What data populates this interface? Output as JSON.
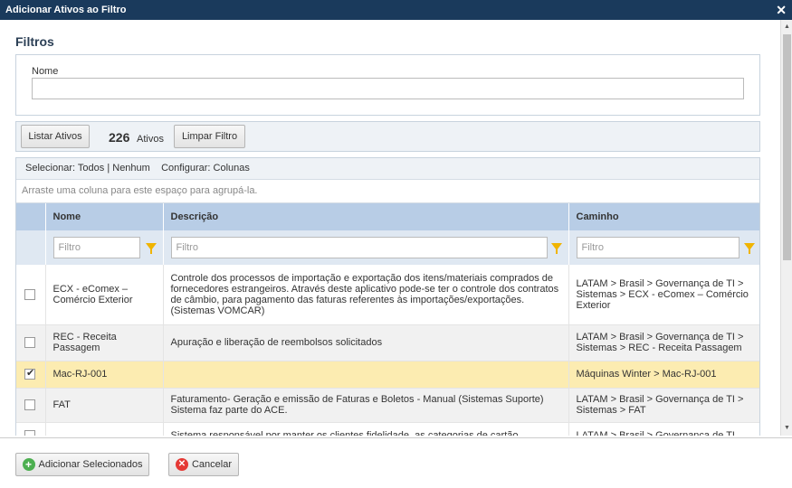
{
  "window": {
    "title": "Adicionar Ativos ao Filtro",
    "close_glyph": "✕"
  },
  "filters": {
    "heading": "Filtros",
    "name_label": "Nome",
    "name_value": ""
  },
  "toolbar": {
    "list_button": "Listar Ativos",
    "count": "226",
    "count_label": "Ativos",
    "clear_button": "Limpar Filtro"
  },
  "grid": {
    "select_label": "Selecionar:",
    "select_all": "Todos",
    "separator": "|",
    "select_none": "Nenhum",
    "configure_label": "Configurar:",
    "columns_link": "Colunas",
    "group_hint": "Arraste uma coluna para este espaço para agrupá-la.",
    "headers": {
      "name": "Nome",
      "description": "Descrição",
      "path": "Caminho"
    },
    "filter_placeholder": "Filtro",
    "rows": [
      {
        "checked": false,
        "name": "ECX - eComex – Comércio Exterior",
        "description": "Controle dos processos de importação e exportação dos itens/materiais comprados de fornecedores estrangeiros. Através deste aplicativo pode-se ter o controle dos contratos de câmbio, para pagamento das faturas referentes às importações/exportações. (Sistemas VOMCAR)",
        "path": "LATAM > Brasil > Governança de TI > Sistemas > ECX - eComex – Comércio Exterior"
      },
      {
        "checked": false,
        "name": "REC - Receita Passagem",
        "description": "Apuração e liberação de reembolsos solicitados",
        "path": "LATAM > Brasil > Governança de TI > Sistemas > REC - Receita Passagem"
      },
      {
        "checked": true,
        "name": "Mac-RJ-001",
        "description": "",
        "path": "Máquinas Winter > Mac-RJ-001"
      },
      {
        "checked": false,
        "name": "FAT",
        "description": "Faturamento- Geração e emissão de Faturas e Boletos - Manual (Sistemas Suporte) Sistema faz parte do ACE.",
        "path": "LATAM > Brasil > Governança de TI > Sistemas > FAT"
      },
      {
        "checked": false,
        "name": "",
        "description": "Sistema responsável por manter os clientes fidelidade, as categorias de cartão",
        "path": "LATAM > Brasil > Governança de TI"
      }
    ]
  },
  "footer": {
    "add_button": "Adicionar Selecionados",
    "cancel_button": "Cancelar"
  }
}
